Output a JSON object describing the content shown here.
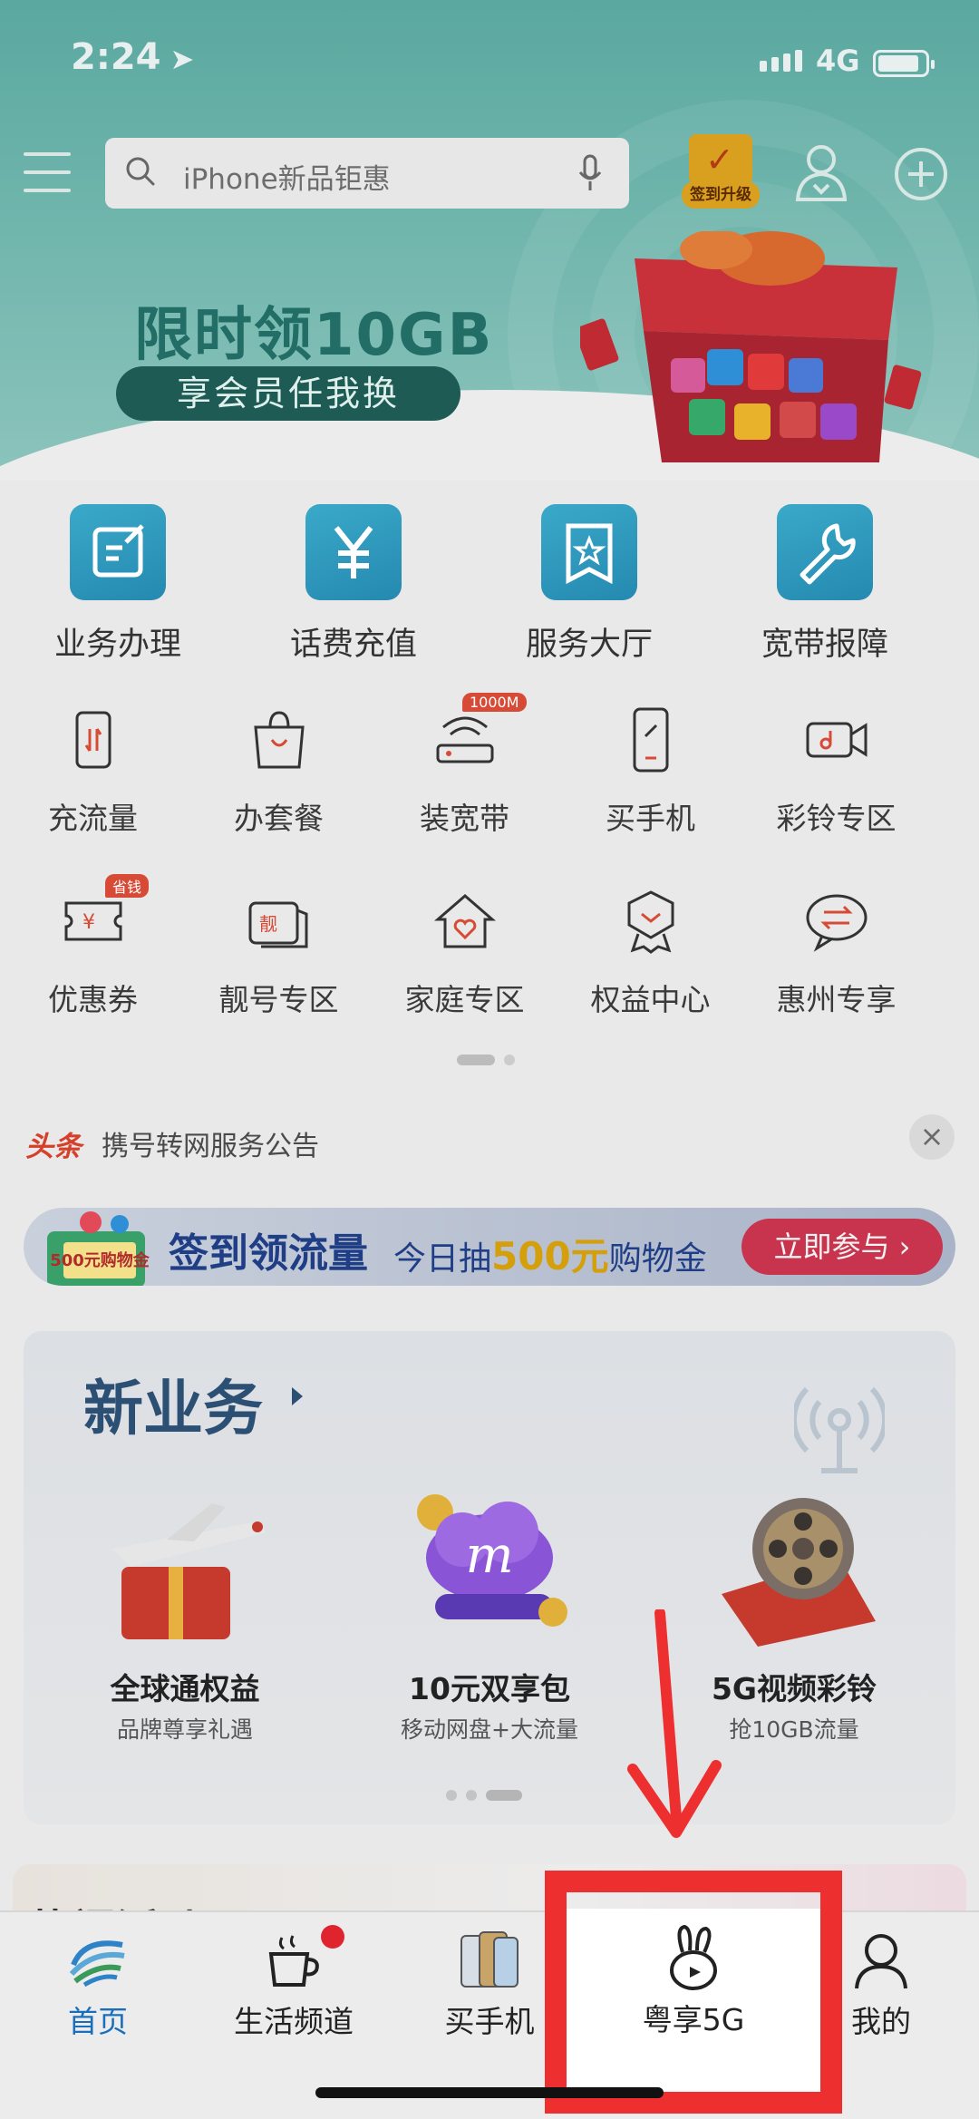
{
  "status": {
    "time": "2:24",
    "network": "4G"
  },
  "header": {
    "search_placeholder": "iPhone新品钜惠",
    "signin_label": "签到升级",
    "promo_title": "限时领10GB",
    "promo_subtitle": "享会员任我换"
  },
  "main_services": [
    {
      "label": "业务办理",
      "icon": "edit-icon"
    },
    {
      "label": "话费充值",
      "icon": "yen-icon"
    },
    {
      "label": "服务大厅",
      "icon": "star-bookmark-icon"
    },
    {
      "label": "宽带报障",
      "icon": "wrench-icon"
    }
  ],
  "quick_row1": [
    {
      "label": "充流量",
      "icon": "phone-data-icon"
    },
    {
      "label": "办套餐",
      "icon": "shopping-bag-icon"
    },
    {
      "label": "装宽带",
      "icon": "router-icon",
      "badge": "1000M"
    },
    {
      "label": "买手机",
      "icon": "mobile-icon"
    },
    {
      "label": "彩铃专区",
      "icon": "video-camera-icon"
    }
  ],
  "quick_row2": [
    {
      "label": "优惠券",
      "icon": "coupon-icon",
      "badge": "省钱"
    },
    {
      "label": "靓号专区",
      "icon": "number-card-icon",
      "badge_text": "靓"
    },
    {
      "label": "家庭专区",
      "icon": "home-heart-icon"
    },
    {
      "label": "权益中心",
      "icon": "badge-icon"
    },
    {
      "label": "惠州专享",
      "icon": "chat-exchange-icon"
    }
  ],
  "news": {
    "tag": "头条",
    "text": "携号转网服务公告",
    "close": "×"
  },
  "banner": {
    "pack_text": "500元购物金",
    "title": "签到领流量",
    "subtitle_pre": "今日抽",
    "subtitle_highlight": "500元",
    "subtitle_post": "购物金",
    "cta": "立即参与 ›"
  },
  "new_business": {
    "title": "新业务",
    "items": [
      {
        "name": "全球通权益",
        "desc": "品牌尊享礼遇"
      },
      {
        "name": "10元双享包",
        "desc": "移动网盘+大流量"
      },
      {
        "name": "5G视频彩铃",
        "desc": "抢10GB流量"
      }
    ]
  },
  "hot": {
    "title": "热门活动"
  },
  "tabs": [
    {
      "label": "首页",
      "icon": "china-mobile-logo-icon"
    },
    {
      "label": "生活频道",
      "icon": "coffee-cup-icon"
    },
    {
      "label": "买手机",
      "icon": "phones-icon"
    },
    {
      "label": "粤享5G",
      "icon": "bunny-icon"
    },
    {
      "label": "我的",
      "icon": "person-icon"
    }
  ],
  "colors": {
    "accent": "#1a6fbd",
    "highlight": "#ee2f2f",
    "tile": "#2f9ac0"
  }
}
